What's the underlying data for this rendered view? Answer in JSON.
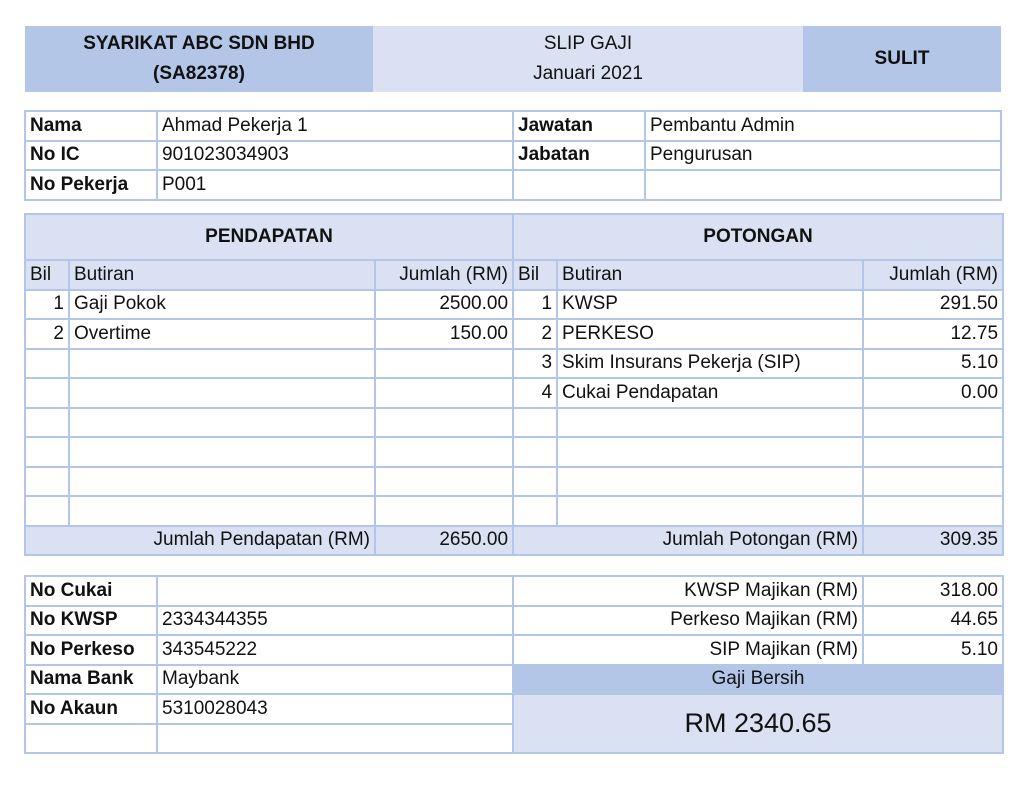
{
  "header": {
    "company_name": "SYARIKAT ABC SDN BHD",
    "company_reg": "(SA82378)",
    "doc_title": "SLIP GAJI",
    "period": "Januari 2021",
    "classification": "SULIT"
  },
  "employee": {
    "rows": [
      {
        "label": "Nama",
        "value": "Ahmad Pekerja 1",
        "label2": "Jawatan",
        "value2": "Pembantu Admin"
      },
      {
        "label": "No IC",
        "value": "901023034903",
        "label2": "Jabatan",
        "value2": "Pengurusan"
      },
      {
        "label": "No Pekerja",
        "value": "P001",
        "label2": "",
        "value2": ""
      }
    ]
  },
  "earnings": {
    "title": "PENDAPATAN",
    "columns": [
      "Bil",
      "Butiran",
      "Jumlah (RM)"
    ],
    "rows": [
      {
        "bil": "1",
        "item": "Gaji Pokok",
        "amount": "2500.00"
      },
      {
        "bil": "2",
        "item": "Overtime",
        "amount": "150.00"
      },
      {
        "bil": "",
        "item": "",
        "amount": ""
      },
      {
        "bil": "",
        "item": "",
        "amount": ""
      },
      {
        "bil": "",
        "item": "",
        "amount": ""
      },
      {
        "bil": "",
        "item": "",
        "amount": ""
      },
      {
        "bil": "",
        "item": "",
        "amount": ""
      },
      {
        "bil": "",
        "item": "",
        "amount": ""
      }
    ],
    "total_label": "Jumlah Pendapatan (RM)",
    "total_value": "2650.00"
  },
  "deductions": {
    "title": "POTONGAN",
    "columns": [
      "Bil",
      "Butiran",
      "Jumlah (RM)"
    ],
    "rows": [
      {
        "bil": "1",
        "item": "KWSP",
        "amount": "291.50"
      },
      {
        "bil": "2",
        "item": "PERKESO",
        "amount": "12.75"
      },
      {
        "bil": "3",
        "item": "Skim Insurans Pekerja (SIP)",
        "amount": "5.10"
      },
      {
        "bil": "4",
        "item": "Cukai Pendapatan",
        "amount": "0.00"
      },
      {
        "bil": "",
        "item": "",
        "amount": ""
      },
      {
        "bil": "",
        "item": "",
        "amount": ""
      },
      {
        "bil": "",
        "item": "",
        "amount": ""
      },
      {
        "bil": "",
        "item": "",
        "amount": ""
      }
    ],
    "total_label": "Jumlah Potongan (RM)",
    "total_value": "309.35"
  },
  "accounts": {
    "rows": [
      {
        "label": "No Cukai",
        "value": ""
      },
      {
        "label": "No KWSP",
        "value": "2334344355"
      },
      {
        "label": "No Perkeso",
        "value": "343545222"
      },
      {
        "label": "Nama Bank",
        "value": "Maybank"
      },
      {
        "label": "No Akaun",
        "value": "5310028043"
      },
      {
        "label": "",
        "value": ""
      }
    ]
  },
  "employer": {
    "rows": [
      {
        "label": "KWSP Majikan (RM)",
        "value": "318.00"
      },
      {
        "label": "Perkeso Majikan (RM)",
        "value": "44.65"
      },
      {
        "label": "SIP Majikan (RM)",
        "value": "5.10"
      }
    ],
    "net_label": "Gaji Bersih",
    "net_value": "RM 2340.65"
  },
  "colors": {
    "dark_fill": "#b4c6e7",
    "light_fill": "#d9e1f2",
    "border": "#b4c6e7"
  }
}
